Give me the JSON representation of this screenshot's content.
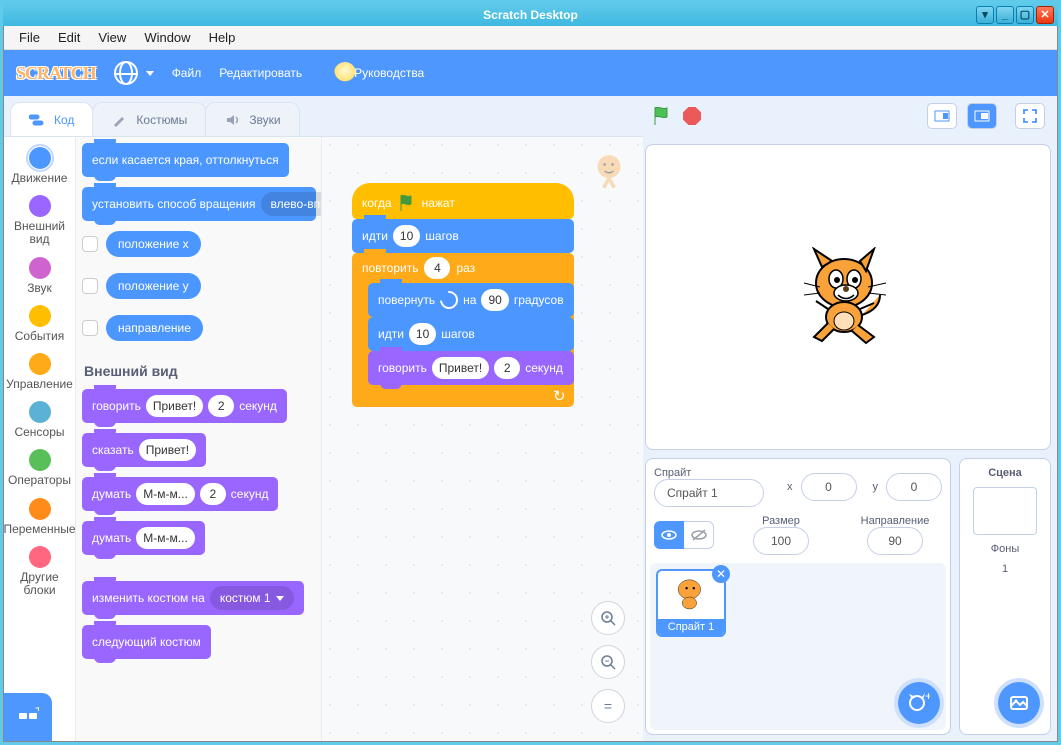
{
  "window": {
    "title": "Scratch Desktop"
  },
  "menubar": [
    "File",
    "Edit",
    "View",
    "Window",
    "Help"
  ],
  "topbar": {
    "logo": "SCRATCH",
    "file": "Файл",
    "edit": "Редактировать",
    "tutorials": "Руководства"
  },
  "tabs": {
    "code": "Код",
    "costumes": "Костюмы",
    "sounds": "Звуки"
  },
  "categories": [
    {
      "id": "motion",
      "label": "Движение",
      "color": "#4c97ff"
    },
    {
      "id": "looks",
      "label": "Внешний вид",
      "color": "#9966ff"
    },
    {
      "id": "sound",
      "label": "Звук",
      "color": "#cf63cf"
    },
    {
      "id": "events",
      "label": "События",
      "color": "#ffbf00"
    },
    {
      "id": "control",
      "label": "Управление",
      "color": "#ffab19"
    },
    {
      "id": "sensing",
      "label": "Сенсоры",
      "color": "#5cb1d6"
    },
    {
      "id": "operators",
      "label": "Операторы",
      "color": "#59c059"
    },
    {
      "id": "variables",
      "label": "Переменные",
      "color": "#ff8c1a"
    },
    {
      "id": "myblocks",
      "label": "Другие блоки",
      "color": "#ff6680"
    }
  ],
  "palette": {
    "edge_bounce": "если касается края, оттолкнуться",
    "set_rotation": "установить способ вращения",
    "rotation_style": "влево-вправо",
    "var_x": "положение x",
    "var_y": "положение y",
    "var_dir": "направление",
    "looks_title": "Внешний вид",
    "say_for": {
      "op": "говорить",
      "msg": "Привет!",
      "n": "2",
      "suf": "секунд"
    },
    "say": {
      "op": "сказать",
      "msg": "Привет!"
    },
    "think_for": {
      "op": "думать",
      "msg": "М-м-м...",
      "n": "2",
      "suf": "секунд"
    },
    "think": {
      "op": "думать",
      "msg": "М-м-м..."
    },
    "switch_costume": {
      "op": "изменить костюм на",
      "val": "костюм 1"
    },
    "next_costume": "следующий костюм"
  },
  "script": {
    "hat_pre": "когда",
    "hat_post": "нажат",
    "move": {
      "op": "идти",
      "n": "10",
      "suf": "шагов"
    },
    "repeat": {
      "op": "повторить",
      "n": "4",
      "suf": "раз"
    },
    "turn": {
      "op": "повернуть",
      "mid": "на",
      "n": "90",
      "suf": "градусов"
    },
    "move2": {
      "op": "идти",
      "n": "10",
      "suf": "шагов"
    },
    "say": {
      "op": "говорить",
      "msg": "Привет!",
      "n": "2",
      "suf": "секунд"
    }
  },
  "sprite_panel": {
    "sprite_lbl": "Спрайт",
    "sprite_name": "Спрайт 1",
    "x_lbl": "x",
    "x_val": "0",
    "y_lbl": "y",
    "y_val": "0",
    "size_lbl": "Размер",
    "size_val": "100",
    "dir_lbl": "Направление",
    "dir_val": "90",
    "thumb_name": "Спрайт 1"
  },
  "scene_panel": {
    "title": "Сцена",
    "backdrops_lbl": "Фоны",
    "backdrops_n": "1"
  }
}
